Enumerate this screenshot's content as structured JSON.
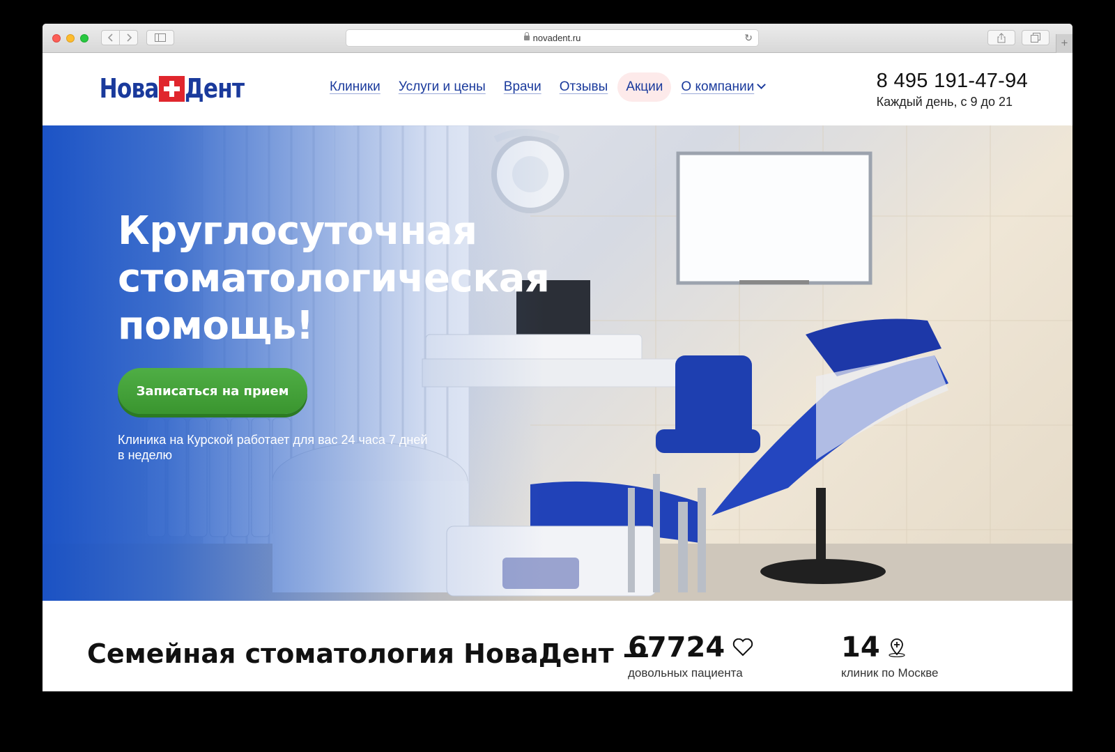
{
  "browser": {
    "url": "novadent.ru"
  },
  "site": {
    "logo": {
      "part1": "Нова",
      "part2": "Дент"
    },
    "nav": [
      {
        "label": "Клиники"
      },
      {
        "label": "Услуги и цены"
      },
      {
        "label": "Врачи"
      },
      {
        "label": "Отзывы"
      },
      {
        "label": "Акции"
      },
      {
        "label": "О компании"
      }
    ],
    "phone": "8 495 191-47-94",
    "hours": "Каждый день, с 9 до 21"
  },
  "hero": {
    "title": "Круглосуточная стоматологическая помощь!",
    "cta_label": "Записаться на прием",
    "subtitle": "Клиника на Курской работает для вас 24 часа 7 дней в неделю"
  },
  "about": {
    "title": "Семейная стоматология НоваДент —",
    "stats": [
      {
        "value": "67724",
        "label": "довольных пациента",
        "icon": "heart-icon"
      },
      {
        "value": "14",
        "label": "клиник по Москве",
        "icon": "location-pin-icon"
      }
    ]
  },
  "colors": {
    "brand_blue": "#1a3a9c",
    "brand_red": "#e0262d",
    "cta_green": "#45a33a",
    "active_nav_bg": "#fdeaea"
  }
}
